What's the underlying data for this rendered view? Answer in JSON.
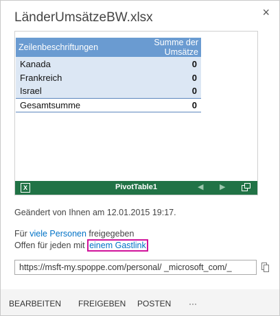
{
  "dialog": {
    "title": "LänderUmsätzeBW.xlsx",
    "close_glyph": "×"
  },
  "pivot_table": {
    "headers": [
      "Zeilenbeschriftungen",
      "Summe der Umsätze"
    ],
    "rows": [
      {
        "label": "Kanada",
        "value": "0"
      },
      {
        "label": "Frankreich",
        "value": "0"
      },
      {
        "label": "Israel",
        "value": "0"
      }
    ],
    "total": {
      "label": "Gesamtsumme",
      "value": "0"
    },
    "header_color": "#6a9bd1",
    "row_color": "#dce7f4"
  },
  "sheet_bar": {
    "sheet_name": "PivotTable1",
    "app_icon": "excel-icon",
    "color": "#217346"
  },
  "info": {
    "modified": "Geändert von Ihnen am 12.01.2015 19:17.",
    "shared_prefix": "Für ",
    "shared_link": "viele Personen",
    "shared_suffix": " freigegeben",
    "open_prefix": "Offen für jeden mit ",
    "guest_link": "einem Gastlink",
    "url": "https://msft-my.spoppe.com/personal/          _microsoft_com/_"
  },
  "actions": {
    "edit": "BEARBEITEN",
    "share": "FREIGEBEN",
    "post": "POSTEN",
    "more": "···"
  },
  "colors": {
    "link": "#0072c6",
    "highlight": "#d0119a"
  }
}
